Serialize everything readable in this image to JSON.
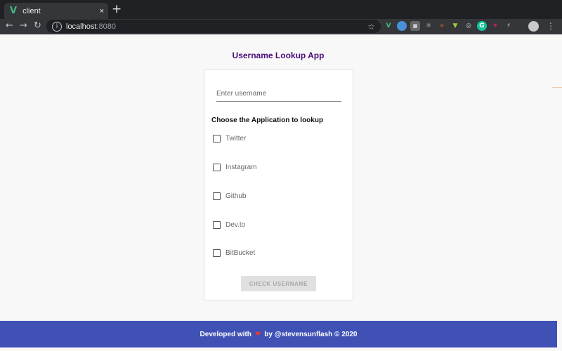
{
  "browser": {
    "tab_title": "client",
    "tab_close": "×",
    "new_tab": "+",
    "url_host": "localhost",
    "url_port": ":8080",
    "nav_back": "←",
    "nav_forward": "→",
    "nav_reload": "↻",
    "menu": "⋮",
    "star": "☆"
  },
  "app": {
    "title": "Username Lookup App",
    "input_placeholder": "Enter username",
    "choose_label": "Choose the Application to lookup",
    "options": [
      {
        "label": "Twitter",
        "checked": false
      },
      {
        "label": "Instagram",
        "checked": false
      },
      {
        "label": "Github",
        "checked": false
      },
      {
        "label": "Dev.to",
        "checked": false
      },
      {
        "label": "BitBucket",
        "checked": false
      }
    ],
    "check_button": "CHECK USERNAME"
  },
  "footer": {
    "prefix": "Developed with",
    "heart": "❤",
    "suffix": "by @stevensunflash © 2020"
  },
  "colors": {
    "accent": "#4a0c7a",
    "footer_bg": "#3f51b5",
    "button_disabled": "#e0e0e0"
  }
}
